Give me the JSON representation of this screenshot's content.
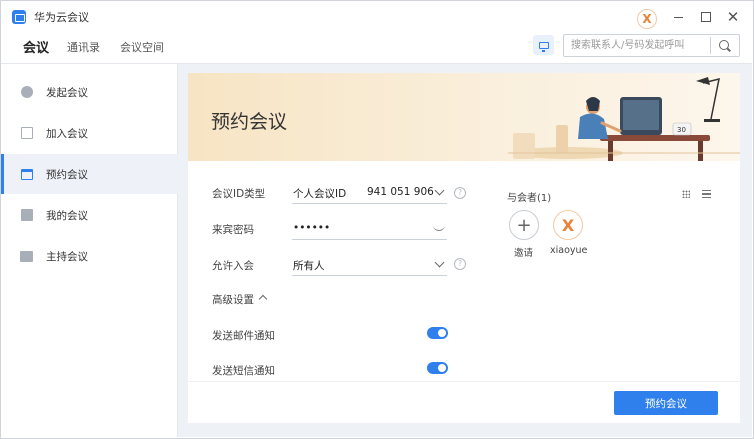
{
  "window": {
    "title": "华为云会议",
    "user_avatar_letter": "X",
    "close_glyph": "✕"
  },
  "nav": {
    "tabs": [
      {
        "label": "会议",
        "active": true
      },
      {
        "label": "通讯录",
        "active": false
      },
      {
        "label": "会议空间",
        "active": false
      }
    ],
    "search": {
      "placeholder": "搜索联系人/号码发起呼叫",
      "value": ""
    }
  },
  "sidebar": {
    "items": [
      {
        "label": "发起会议",
        "icon": "phone-icon",
        "active": false
      },
      {
        "label": "加入会议",
        "icon": "join-icon",
        "active": false
      },
      {
        "label": "预约会议",
        "icon": "calendar-icon",
        "active": true
      },
      {
        "label": "我的会议",
        "icon": "list-icon",
        "active": false
      },
      {
        "label": "主持会议",
        "icon": "host-icon",
        "active": false
      }
    ]
  },
  "form": {
    "banner_title": "预约会议",
    "id_type_label": "会议ID类型",
    "id_type_value": "个人会议ID",
    "meeting_id": "941 051 906",
    "guest_password_label": "来宾密码",
    "guest_password_value": "••••••",
    "allow_join_label": "允许入会",
    "allow_join_value": "所有人",
    "advanced_label": "高级设置",
    "email_notify_label": "发送邮件通知",
    "email_notify_on": true,
    "sms_notify_label": "发送短信通知",
    "sms_notify_on": true,
    "help_glyph": "?",
    "submit_label": "预约会议"
  },
  "participants": {
    "title": "与会者(1)",
    "invite_label": "邀请",
    "invite_glyph": "+",
    "members": [
      {
        "name": "xiaoyue",
        "avatar_letter": "X"
      }
    ]
  },
  "illustration": {
    "calendar_number": "30"
  },
  "colors": {
    "accent": "#2f80ed",
    "banner": "#f7e4c4",
    "avatar": "#e8823a"
  }
}
